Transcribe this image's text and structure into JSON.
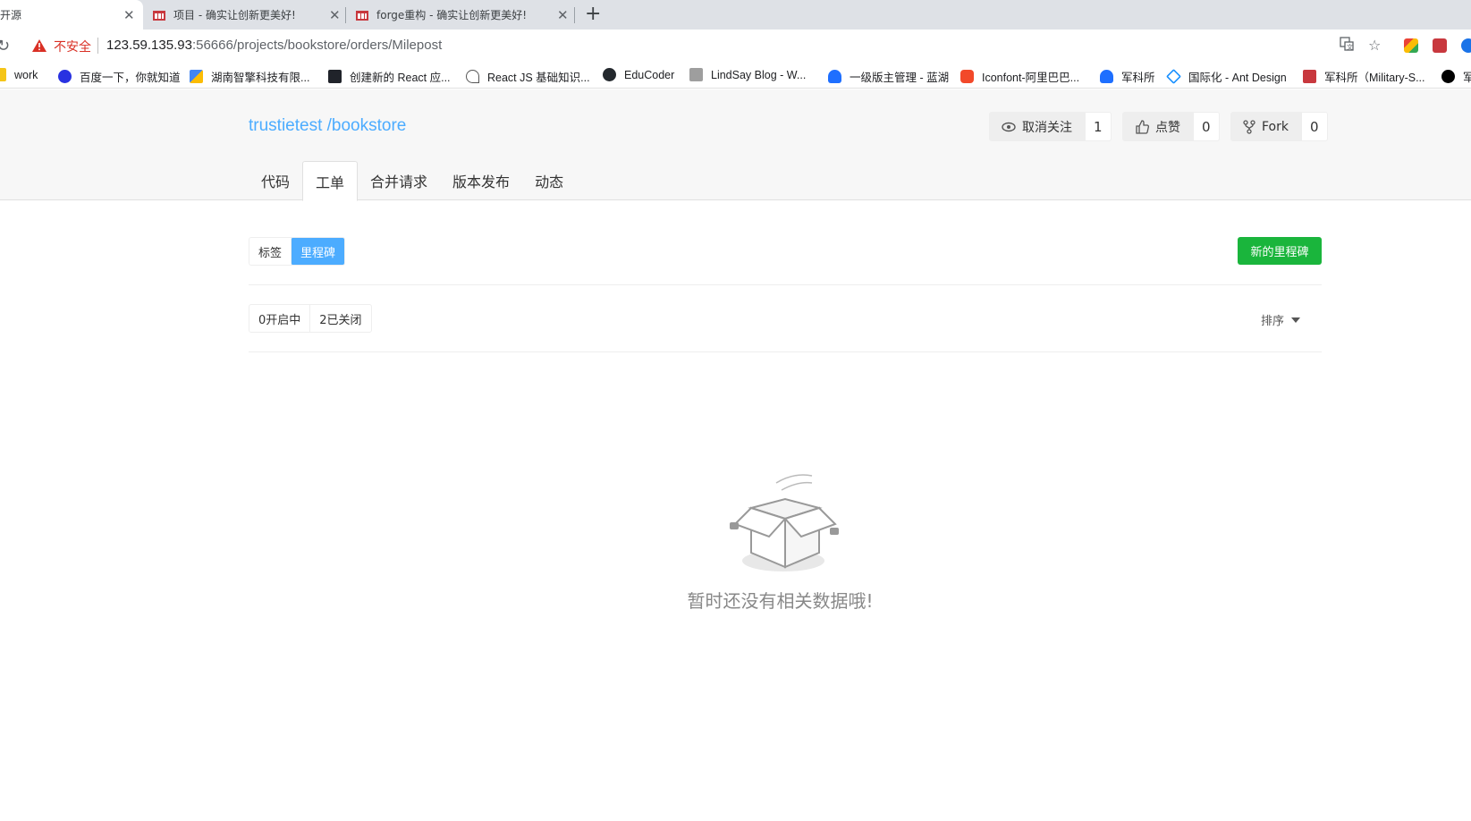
{
  "browser": {
    "tabs": [
      {
        "title": "开源",
        "active": true
      },
      {
        "title": "项目 - 确实让创新更美好!",
        "active": false
      },
      {
        "title": "forge重构 - 确实让创新更美好!",
        "active": false
      }
    ],
    "address": {
      "security_label": "不安全",
      "url_host": "123.59.135.93",
      "url_rest": ":56666/projects/bookstore/orders/Milepost"
    },
    "bookmarks": [
      {
        "label": "work",
        "icon": "folder-icon",
        "color": "#f5c518"
      },
      {
        "label": "百度一下，你就知道",
        "icon": "baidu-icon",
        "color": "#2932e1"
      },
      {
        "label": "湖南智擎科技有限...",
        "icon": "zhiqing-icon",
        "color": "#e8453c"
      },
      {
        "label": "创建新的 React 应...",
        "icon": "react-icon",
        "color": "#20232a"
      },
      {
        "label": "React JS 基础知识...",
        "icon": "react-js-icon",
        "color": "#555555"
      },
      {
        "label": "EduCoder",
        "icon": "github-icon",
        "color": "#24292e"
      },
      {
        "label": "LindSay Blog - W...",
        "icon": "blog-icon",
        "color": "#9e9e9e"
      },
      {
        "label": "一级版主管理 - 蓝湖",
        "icon": "lanhu-icon",
        "color": "#1e6fff"
      },
      {
        "label": "Iconfont-阿里巴巴...",
        "icon": "iconfont-icon",
        "color": "#f2492a"
      },
      {
        "label": "军科所",
        "icon": "junke-icon",
        "color": "#1e6fff"
      },
      {
        "label": "国际化 - Ant Design",
        "icon": "antd-icon",
        "color": "#1890ff"
      },
      {
        "label": "军科所（Military-S...",
        "icon": "military-icon",
        "color": "#c8383e"
      },
      {
        "label": "军",
        "icon": "dark-icon",
        "color": "#000000"
      }
    ]
  },
  "project": {
    "title": "trustietest /bookstore",
    "actions": [
      {
        "label": "取消关注",
        "count": "1",
        "icon": "eye-icon"
      },
      {
        "label": "点赞",
        "count": "0",
        "icon": "thumbs-up-icon"
      },
      {
        "label": "Fork",
        "count": "0",
        "icon": "fork-icon"
      }
    ],
    "tabs": [
      {
        "label": "代码",
        "active": false
      },
      {
        "label": "工单",
        "active": true
      },
      {
        "label": "合并请求",
        "active": false
      },
      {
        "label": "版本发布",
        "active": false
      },
      {
        "label": "动态",
        "active": false
      }
    ]
  },
  "milestones": {
    "type_toggle": [
      {
        "label": "标签",
        "active": false
      },
      {
        "label": "里程碑",
        "active": true
      }
    ],
    "new_button": "新的里程碑",
    "state_toggle": [
      {
        "label": "0开启中"
      },
      {
        "label": "2已关闭"
      }
    ],
    "sort_label": "排序",
    "empty_text": "暂时还没有相关数据哦!"
  },
  "colors": {
    "link_blue": "#4cacff",
    "primary_green": "#1ab53c",
    "warning_red": "#d93025"
  }
}
